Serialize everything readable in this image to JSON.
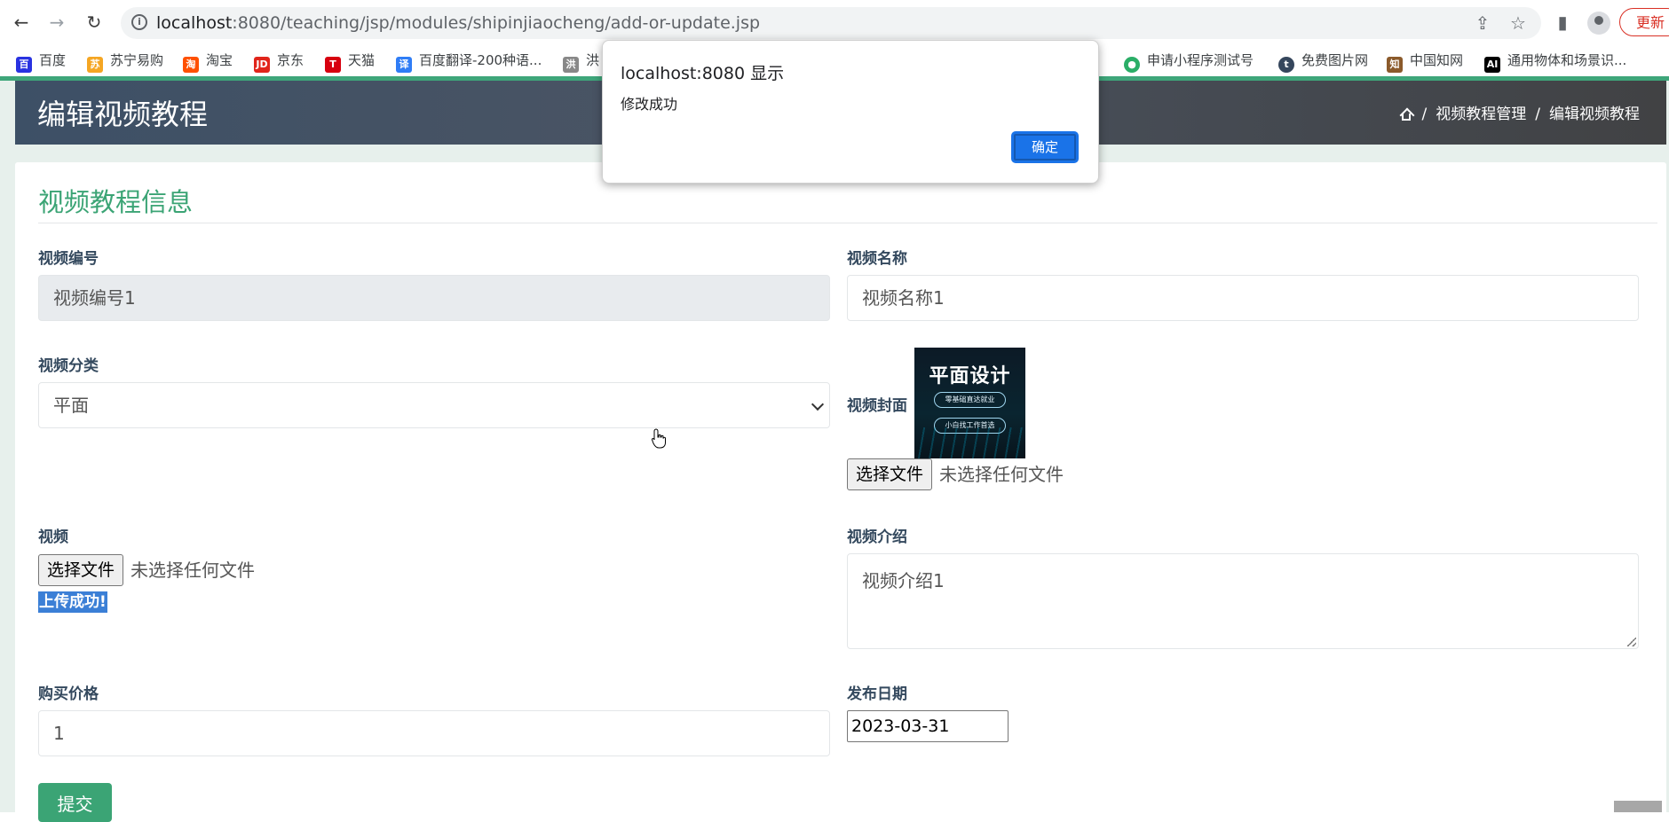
{
  "browser": {
    "url_host": "localhost",
    "url_rest": ":8080/teaching/jsp/modules/shipinjiaocheng/add-or-update.jsp",
    "update_label": "更新"
  },
  "bookmarks": [
    {
      "label": "百度",
      "icon": "baidu-icon",
      "color": "#2932e1"
    },
    {
      "label": "苏宁易购",
      "icon": "suning-icon",
      "color": "#f5a623"
    },
    {
      "label": "淘宝",
      "icon": "taobao-icon",
      "color": "#ff5000"
    },
    {
      "label": "京东",
      "icon": "jd-icon",
      "color": "#e1251b"
    },
    {
      "label": "天猫",
      "icon": "tmall-icon",
      "color": "#d7000f"
    },
    {
      "label": "百度翻译-200种语...",
      "icon": "translate-icon",
      "color": "#2f7df6"
    },
    {
      "label": "洪",
      "icon": "hong-icon",
      "color": "#888888"
    },
    {
      "label": "申请小程序测试号",
      "icon": "wechat-icon",
      "color": "#2aae67"
    },
    {
      "label": "免费图片网",
      "icon": "tumblr-icon",
      "color": "#35465c"
    },
    {
      "label": "中国知网",
      "icon": "cnki-icon",
      "color": "#8b5a2b"
    },
    {
      "label": "通用物体和场景识...",
      "icon": "ai-icon",
      "color": "#000000"
    }
  ],
  "header": {
    "title": "编辑视频教程",
    "breadcrumb": [
      "视频教程管理",
      "编辑视频教程"
    ]
  },
  "form": {
    "section_title": "视频教程信息",
    "video_no": {
      "label": "视频编号",
      "value": "视频编号1"
    },
    "video_name": {
      "label": "视频名称",
      "value": "视频名称1"
    },
    "category": {
      "label": "视频分类",
      "value": "平面"
    },
    "cover": {
      "label": "视频封面",
      "image_title": "平面设计",
      "pill1": "零基础直达就业",
      "pill2": "小白找工作首选"
    },
    "cover_file": {
      "button": "选择文件",
      "status": "未选择任何文件"
    },
    "video": {
      "label": "视频",
      "button": "选择文件",
      "status": "未选择任何文件",
      "upload_msg": "上传成功!"
    },
    "intro": {
      "label": "视频介绍",
      "value": "视频介绍1"
    },
    "price": {
      "label": "购买价格",
      "value": "1"
    },
    "publish_date": {
      "label": "发布日期",
      "value": "2023-03-31"
    },
    "submit_label": "提交"
  },
  "alert": {
    "title": "localhost:8080 显示",
    "message": "修改成功",
    "ok_label": "确定"
  },
  "colors": {
    "accent": "#3ba475",
    "header_start": "#3d5066",
    "header_end": "#414244",
    "dialog_button": "#1a73e8"
  }
}
